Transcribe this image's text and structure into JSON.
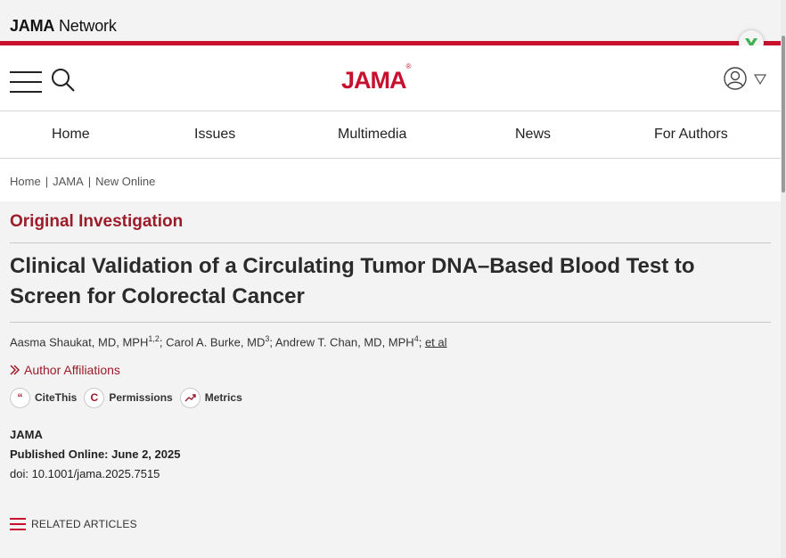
{
  "network": {
    "logo_bold": "JAMA",
    "logo_rest": " Network"
  },
  "header": {
    "brand": "JAMA",
    "brand_mark": "®"
  },
  "nav": {
    "items": [
      "Home",
      "Issues",
      "Multimedia",
      "News",
      "For Authors"
    ]
  },
  "breadcrumb": {
    "items": [
      "Home",
      "JAMA",
      "New Online"
    ],
    "separator": "|"
  },
  "article": {
    "type": "Original Investigation",
    "title": "Clinical Validation of a Circulating Tumor DNA–Based Blood Test to Screen for Colorectal Cancer",
    "authors": [
      {
        "name": "Aasma Shaukat, MD, MPH",
        "sup": "1,2"
      },
      {
        "name": "Carol A. Burke, MD",
        "sup": "3"
      },
      {
        "name": "Andrew T. Chan, MD, MPH",
        "sup": "4"
      }
    ],
    "et_al": "et al",
    "affiliations_label": "Author Affiliations",
    "tools": {
      "cite": "CiteThis",
      "permissions": "Permissions",
      "metrics": "Metrics"
    },
    "journal": "JAMA",
    "published": "Published Online: June 2, 2025",
    "doi": "doi: 10.1001/jama.2025.7515",
    "related_label": "RELATED ARTICLES"
  },
  "colors": {
    "brand_red": "#c8102e",
    "accent_red": "#9b1c2a"
  }
}
